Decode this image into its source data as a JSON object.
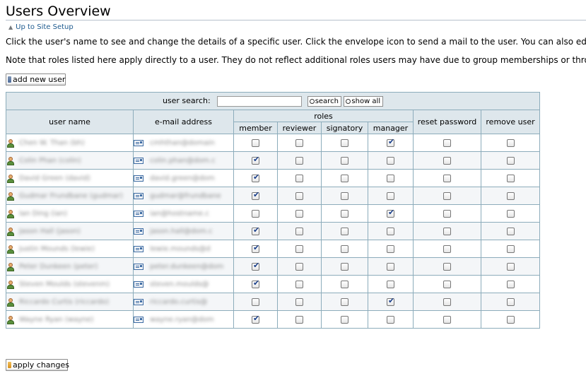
{
  "page": {
    "title": "Users Overview",
    "up_link": "Up to Site Setup",
    "description1": "Click the user's name to see and change the details of a specific user. Click the envelope icon to send a mail to the user. You can also edit",
    "description2": "Note that roles listed here apply directly to a user. They do not reflect additional roles users may have due to group memberships or throu",
    "add_user_label": "add new user",
    "apply_label": "apply changes"
  },
  "search": {
    "label": "user search:",
    "value": "",
    "search_button": "search",
    "show_all_button": "show all"
  },
  "table": {
    "headers": {
      "user_name": "user name",
      "email": "e-mail address",
      "roles": "roles",
      "member": "member",
      "reviewer": "reviewer",
      "signatory": "signatory",
      "manager": "manager",
      "reset_password": "reset password",
      "remove_user": "remove user"
    },
    "rows": [
      {
        "name": "Chen W. Than (bh)",
        "email": "cmhthan@domain",
        "member": false,
        "reviewer": false,
        "signatory": false,
        "manager": true,
        "reset": false,
        "remove": false
      },
      {
        "name": "Colin Phan (colin)",
        "email": "colin.phan@dom.c",
        "member": true,
        "reviewer": false,
        "signatory": false,
        "manager": false,
        "reset": false,
        "remove": false
      },
      {
        "name": "David Green (david)",
        "email": "david.green@dom",
        "member": true,
        "reviewer": false,
        "signatory": false,
        "manager": false,
        "reset": false,
        "remove": false
      },
      {
        "name": "Gudmar Frundbane (gudmar)",
        "email": "gudmar@frundbane",
        "member": true,
        "reviewer": false,
        "signatory": false,
        "manager": false,
        "reset": false,
        "remove": false
      },
      {
        "name": "Ian Ding (ian)",
        "email": "ian@hostname.c",
        "member": false,
        "reviewer": false,
        "signatory": false,
        "manager": true,
        "reset": false,
        "remove": false
      },
      {
        "name": "Jason Hall (jason)",
        "email": "jason.hall@dom.c",
        "member": true,
        "reviewer": false,
        "signatory": false,
        "manager": false,
        "reset": false,
        "remove": false
      },
      {
        "name": "Justin Mounds (lewie)",
        "email": "lewie.mounds@d",
        "member": true,
        "reviewer": false,
        "signatory": false,
        "manager": false,
        "reset": false,
        "remove": false
      },
      {
        "name": "Peter Dunkeen (peter)",
        "email": "peter.dunkeen@dom",
        "member": true,
        "reviewer": false,
        "signatory": false,
        "manager": false,
        "reset": false,
        "remove": false
      },
      {
        "name": "Steven Moulds (stevenm)",
        "email": "steven.moulds@",
        "member": true,
        "reviewer": false,
        "signatory": false,
        "manager": false,
        "reset": false,
        "remove": false
      },
      {
        "name": "Riccardo Curtis (riccardo)",
        "email": "riccardo.curtis@",
        "member": false,
        "reviewer": false,
        "signatory": false,
        "manager": true,
        "reset": false,
        "remove": false
      },
      {
        "name": "Wayne Ryan (wayne)",
        "email": "wayne.ryan@dom",
        "member": true,
        "reviewer": false,
        "signatory": false,
        "manager": false,
        "reset": false,
        "remove": false
      }
    ]
  }
}
